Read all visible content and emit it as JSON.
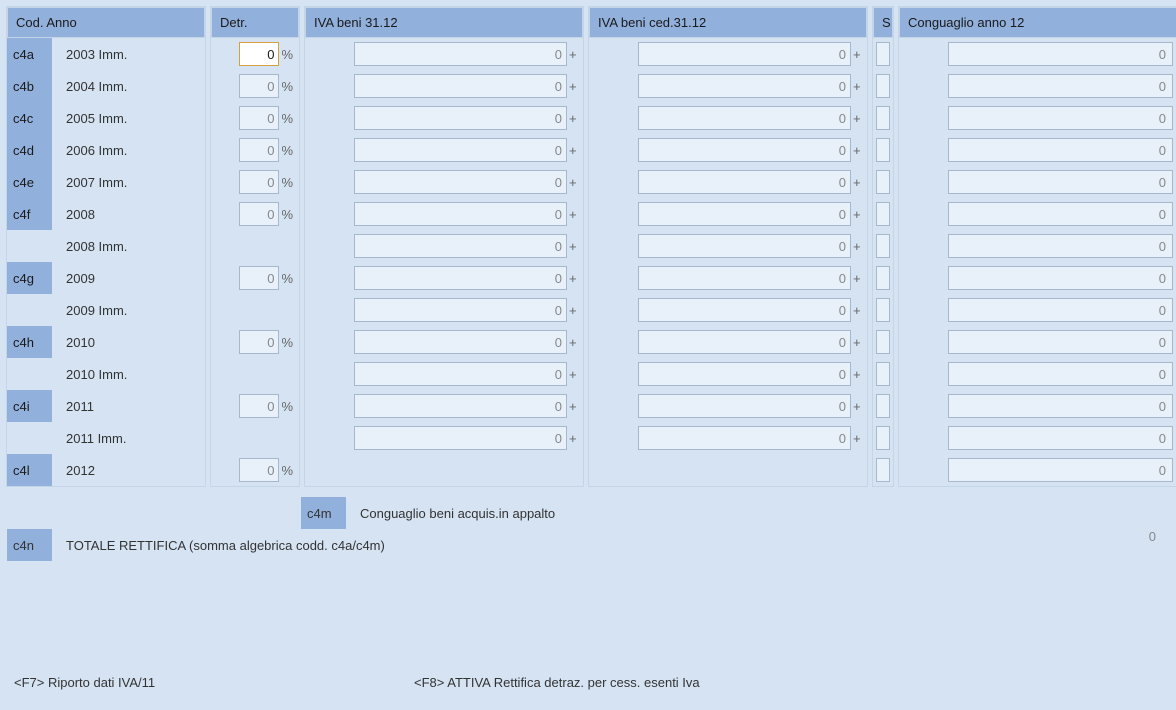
{
  "headers": {
    "codanno": "Cod. Anno",
    "detr": "Detr.",
    "iva1": "IVA beni 31.12",
    "iva2": "IVA beni ced.31.12",
    "s": "S",
    "cong": "Conguaglio anno 12"
  },
  "rows": [
    {
      "cod": "c4a",
      "anno": "2003 Imm.",
      "detr": "0",
      "detrActive": true,
      "iva1": "0",
      "iva2": "0",
      "s": true,
      "cong": "0"
    },
    {
      "cod": "c4b",
      "anno": "2004 Imm.",
      "detr": "0",
      "iva1": "0",
      "iva2": "0",
      "s": true,
      "cong": "0"
    },
    {
      "cod": "c4c",
      "anno": "2005 Imm.",
      "detr": "0",
      "iva1": "0",
      "iva2": "0",
      "s": true,
      "cong": "0"
    },
    {
      "cod": "c4d",
      "anno": "2006 Imm.",
      "detr": "0",
      "iva1": "0",
      "iva2": "0",
      "s": true,
      "cong": "0"
    },
    {
      "cod": "c4e",
      "anno": "2007 Imm.",
      "detr": "0",
      "iva1": "0",
      "iva2": "0",
      "s": true,
      "cong": "0"
    },
    {
      "cod": "c4f",
      "anno": "2008",
      "detr": "0",
      "iva1": "0",
      "iva2": "0",
      "s": true,
      "cong": "0"
    },
    {
      "cod": "",
      "anno": "2008 Imm.",
      "detr": null,
      "iva1": "0",
      "iva2": "0",
      "s": true,
      "cong": "0"
    },
    {
      "cod": "c4g",
      "anno": "2009",
      "detr": "0",
      "iva1": "0",
      "iva2": "0",
      "s": true,
      "cong": "0"
    },
    {
      "cod": "",
      "anno": "2009 Imm.",
      "detr": null,
      "iva1": "0",
      "iva2": "0",
      "s": true,
      "cong": "0"
    },
    {
      "cod": "c4h",
      "anno": "2010",
      "detr": "0",
      "iva1": "0",
      "iva2": "0",
      "s": true,
      "cong": "0"
    },
    {
      "cod": "",
      "anno": "2010 Imm.",
      "detr": null,
      "iva1": "0",
      "iva2": "0",
      "s": true,
      "cong": "0"
    },
    {
      "cod": "c4i",
      "anno": "2011",
      "detr": "0",
      "iva1": "0",
      "iva2": "0",
      "s": true,
      "cong": "0"
    },
    {
      "cod": "",
      "anno": "2011 Imm.",
      "detr": null,
      "iva1": "0",
      "iva2": "0",
      "s": true,
      "cong": "0"
    },
    {
      "cod": "c4l",
      "anno": "2012",
      "detr": "0",
      "iva1": null,
      "iva2": null,
      "s": true,
      "cong": "0",
      "c4m": true
    }
  ],
  "c4m": {
    "cod": "c4m",
    "label": "Conguaglio beni acquis.in appalto"
  },
  "totale": {
    "cod": "c4n",
    "label": "TOTALE RETTIFICA (somma algebrica codd. c4a/c4m)",
    "val": "0"
  },
  "footer": {
    "f7": "<F7> Riporto dati IVA/11",
    "f8": "<F8> ATTIVA Rettifica detraz. per cess. esenti Iva"
  },
  "pct": "%",
  "plus": "+"
}
